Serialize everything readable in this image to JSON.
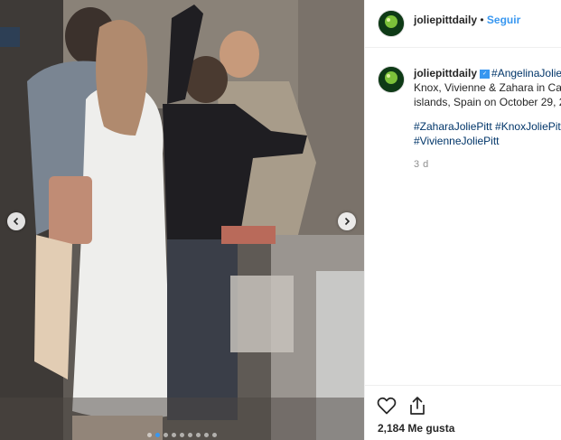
{
  "post": {
    "username": "joliepittdaily",
    "separator": "•",
    "follow_label": "Seguir",
    "caption": {
      "username": "joliepittdaily",
      "verified_glyph": "✓",
      "first_tag": "#AngelinaJolie",
      "line2": "Knox, Vivienne & Zahara in Can",
      "line3": "islands, Spain on October 29, 2",
      "hashtags_line1": "#ZaharaJoliePitt #KnoxJoliePitt",
      "hashtags_line2": "#VivienneJoliePitt"
    },
    "time_ago": "3 d",
    "likes": "2,184 Me gusta",
    "carousel": {
      "slide_count": 9,
      "active_index": 1
    }
  },
  "colors": {
    "link_blue": "#3897f0",
    "hashtag": "#003569",
    "text": "#262626",
    "muted": "#8e8e8e",
    "border": "#efefef"
  },
  "icons": [
    "chevron-left-icon",
    "chevron-right-icon",
    "heart-icon",
    "share-icon",
    "verified-badge-icon"
  ]
}
